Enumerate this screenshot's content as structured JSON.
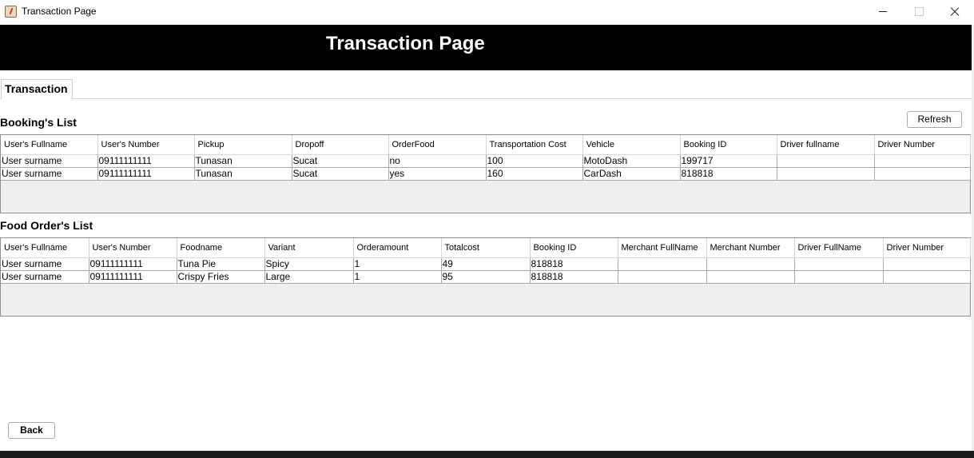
{
  "window": {
    "title": "Transaction Page"
  },
  "header": {
    "title": "Transaction Page"
  },
  "tabs": [
    {
      "label": "Transaction"
    }
  ],
  "bookings": {
    "title": "Booking's List",
    "refresh_label": "Refresh",
    "columns": [
      "User's Fullname",
      "User's Number",
      "Pickup",
      "Dropoff",
      "OrderFood",
      "Transportation Cost",
      "Vehicle",
      "Booking ID",
      "Driver fullname",
      "Driver Number"
    ],
    "rows": [
      [
        "User surname",
        "09111111111",
        "Tunasan",
        "Sucat",
        "no",
        "100",
        "MotoDash",
        "199717",
        "",
        ""
      ],
      [
        "User surname",
        "09111111111",
        "Tunasan",
        "Sucat",
        "yes",
        "160",
        "CarDash",
        "818818",
        "",
        ""
      ]
    ]
  },
  "food_orders": {
    "title": "Food Order's List",
    "columns": [
      "User's Fullname",
      "User's Number",
      "Foodname",
      "Variant",
      "Orderamount",
      "Totalcost",
      "Booking ID",
      "Merchant FullName",
      "Merchant Number",
      "Driver FullName",
      "Driver Number"
    ],
    "rows": [
      [
        "User surname",
        "09111111111",
        "Tuna Pie",
        "Spicy",
        "1",
        "49",
        "818818",
        "",
        "",
        "",
        ""
      ],
      [
        "User surname",
        "09111111111",
        "Crispy Fries",
        "Large",
        "1",
        "95",
        "818818",
        "",
        "",
        "",
        ""
      ]
    ]
  },
  "footer": {
    "back_label": "Back"
  }
}
